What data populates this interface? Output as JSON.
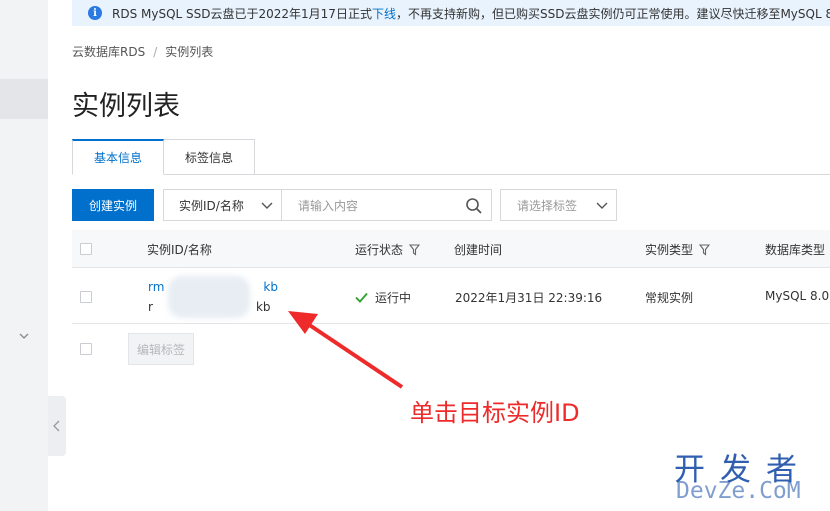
{
  "notice": {
    "text_before": "RDS MySQL SSD云盘已于2022年1月17日正式",
    "link": "下线",
    "text_after": "，不再支持新购，但已购买SSD云盘实例仍可正常使用。建议尽快迁移至MySQL 8"
  },
  "breadcrumb": {
    "root": "云数据库RDS",
    "separator": "/",
    "current": "实例列表"
  },
  "page_title": "实例列表",
  "tabs": [
    {
      "label": "基本信息",
      "active": true
    },
    {
      "label": "标签信息",
      "active": false
    }
  ],
  "toolbar": {
    "create_label": "创建实例",
    "search_field_select": "实例ID/名称",
    "search_placeholder": "请输入内容",
    "tag_select_placeholder": "请选择标签"
  },
  "table": {
    "columns": {
      "id_name": "实例ID/名称",
      "status": "运行状态",
      "created": "创建时间",
      "type": "实例类型",
      "engine": "数据库类型"
    },
    "rows": [
      {
        "id_prefix": "rm",
        "id_suffix": "kb",
        "name_prefix": "r",
        "name_suffix": "kb",
        "status": "运行中",
        "created": "2022年1月31日 22:39:16",
        "type": "常规实例",
        "engine": "MySQL 8.0"
      }
    ],
    "edit_tags_label": "编辑标签"
  },
  "annotation": {
    "text": "单击目标实例ID",
    "color": "#ee2a2a"
  },
  "watermark": {
    "line1": "开发者",
    "line2": "DevZe.CoM"
  },
  "colors": {
    "primary": "#0070cc",
    "notice_bg": "#e8f3fd",
    "success": "#2ca02c"
  }
}
